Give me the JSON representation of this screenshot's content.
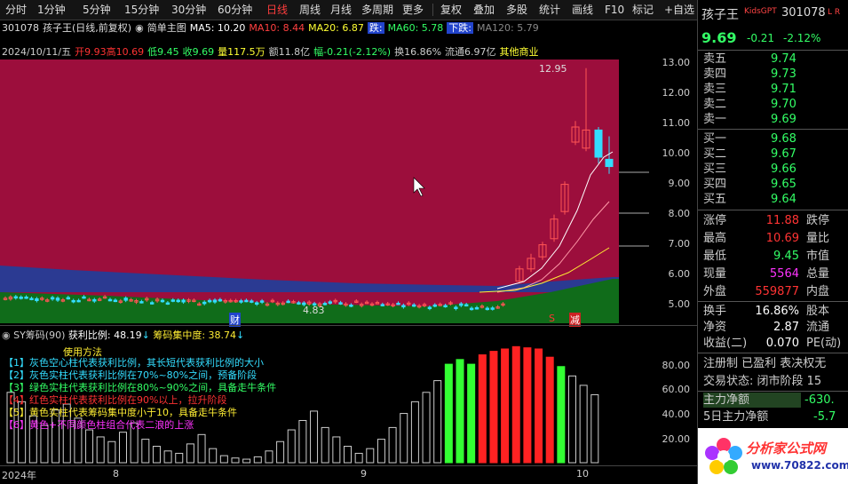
{
  "toolbar": {
    "items": [
      "分时",
      "1分钟",
      "5分钟",
      "15分钟",
      "30分钟",
      "60分钟",
      "日线",
      "周线",
      "月线",
      "多周期",
      "更多",
      "复权",
      "叠加",
      "多股",
      "统计",
      "画线",
      "F10",
      "标记",
      "+自选",
      "返回"
    ]
  },
  "info": {
    "code": "301078",
    "name_title": "孩子王(日线,前复权)",
    "indicator_name": "简单主图",
    "ma5": "MA5: 10.20",
    "ma10": "MA10: 8.44",
    "ma20": "MA20: 6.87",
    "badge_pct": "跌:",
    "ma60": "MA60: 5.78",
    "ma60_prefix": "下跌:",
    "ma120": "MA120: 5.79",
    "date": "2024/10/11/五",
    "open": "开9.93",
    "high": "高10.69",
    "low": "低9.45",
    "close": "收9.69",
    "vol": "量117.5万",
    "amount": "额11.8亿",
    "change": "幅-0.21(-2.12%)",
    "turnover": "换16.86%",
    "float": "流通6.97亿",
    "industry": "其他商业"
  },
  "main_chart": {
    "y_labels": [
      "13.00",
      "12.00",
      "11.00",
      "10.00",
      "9.00",
      "8.00",
      "7.00",
      "6.00",
      "5.00"
    ],
    "peak_label": "12.95",
    "low_label": "4.83",
    "marker_cai": "财",
    "marker_s": "S",
    "marker_jian": "减"
  },
  "sub_chart": {
    "title": "SY筹码(90)",
    "profit_label": "获利比例: 48.19",
    "concentration_label": "筹码集中度: 38.74",
    "guide_title": "使用方法",
    "legend": [
      "【1】灰色空心柱代表获利比例，其长短代表获利比例的大小",
      "【2】灰色实柱代表获利比例在70%~80%之间，预备阶段",
      "【3】绿色实柱代表获利比例在80%~90%之间，具备走牛条件",
      "【4】红色实柱代表获利比例在90%以上，拉升阶段",
      "【5】黄色实柱代表筹码集中度小于10，具备走牛条件",
      "【6】黄色+不同颜色柱组合代表二浪的上涨",
      "【7】"
    ],
    "y_labels": [
      "80.00",
      "60.00",
      "40.00",
      "20.00"
    ],
    "bars": [
      {
        "v": 60,
        "t": "h"
      },
      {
        "v": 52,
        "t": "h"
      },
      {
        "v": 40,
        "t": "h"
      },
      {
        "v": 32,
        "t": "h"
      },
      {
        "v": 45,
        "t": "h"
      },
      {
        "v": 50,
        "t": "h"
      },
      {
        "v": 38,
        "t": "h"
      },
      {
        "v": 28,
        "t": "h"
      },
      {
        "v": 22,
        "t": "h"
      },
      {
        "v": 18,
        "t": "h"
      },
      {
        "v": 26,
        "t": "h"
      },
      {
        "v": 34,
        "t": "h"
      },
      {
        "v": 20,
        "t": "h"
      },
      {
        "v": 14,
        "t": "h"
      },
      {
        "v": 10,
        "t": "h"
      },
      {
        "v": 8,
        "t": "h"
      },
      {
        "v": 16,
        "t": "h"
      },
      {
        "v": 24,
        "t": "h"
      },
      {
        "v": 12,
        "t": "h"
      },
      {
        "v": 6,
        "t": "h"
      },
      {
        "v": 4,
        "t": "h"
      },
      {
        "v": 3,
        "t": "h"
      },
      {
        "v": 5,
        "t": "h"
      },
      {
        "v": 10,
        "t": "h"
      },
      {
        "v": 18,
        "t": "h"
      },
      {
        "v": 28,
        "t": "h"
      },
      {
        "v": 36,
        "t": "h"
      },
      {
        "v": 44,
        "t": "h"
      },
      {
        "v": 30,
        "t": "h"
      },
      {
        "v": 22,
        "t": "h"
      },
      {
        "v": 14,
        "t": "h"
      },
      {
        "v": 8,
        "t": "h"
      },
      {
        "v": 12,
        "t": "h"
      },
      {
        "v": 20,
        "t": "h"
      },
      {
        "v": 30,
        "t": "h"
      },
      {
        "v": 42,
        "t": "h"
      },
      {
        "v": 52,
        "t": "h"
      },
      {
        "v": 60,
        "t": "h"
      },
      {
        "v": 70,
        "t": "h"
      },
      {
        "v": 84,
        "t": "g"
      },
      {
        "v": 88,
        "t": "g"
      },
      {
        "v": 84,
        "t": "g"
      },
      {
        "v": 92,
        "t": "r"
      },
      {
        "v": 95,
        "t": "r"
      },
      {
        "v": 97,
        "t": "r"
      },
      {
        "v": 99,
        "t": "r"
      },
      {
        "v": 98,
        "t": "r"
      },
      {
        "v": 97,
        "t": "r"
      },
      {
        "v": 90,
        "t": "r"
      },
      {
        "v": 82,
        "t": "g"
      },
      {
        "v": 74,
        "t": "h"
      },
      {
        "v": 66,
        "t": "h"
      },
      {
        "v": 58,
        "t": "h"
      }
    ]
  },
  "x_labels": [
    "2024年",
    "8",
    "9",
    "10"
  ],
  "quote": {
    "name": "孩子王",
    "badge": "KidsGPT",
    "code": "301078",
    "lr": "L R",
    "price": "9.69",
    "change": "-0.21",
    "pct": "-2.12%",
    "sells": [
      {
        "label": "卖五",
        "price": "9.74"
      },
      {
        "label": "卖四",
        "price": "9.73"
      },
      {
        "label": "卖三",
        "price": "9.71"
      },
      {
        "label": "卖二",
        "price": "9.70"
      },
      {
        "label": "卖一",
        "price": "9.69"
      }
    ],
    "buys": [
      {
        "label": "买一",
        "price": "9.68"
      },
      {
        "label": "买二",
        "price": "9.67"
      },
      {
        "label": "买三",
        "price": "9.66"
      },
      {
        "label": "买四",
        "price": "9.65"
      },
      {
        "label": "买五",
        "price": "9.64"
      }
    ],
    "stats": [
      {
        "label": "涨停",
        "value": "11.88",
        "label2": "跌停"
      },
      {
        "label": "最高",
        "value": "10.69",
        "label2": "量比"
      },
      {
        "label": "最低",
        "value": "9.45",
        "label2": "市值"
      },
      {
        "label": "现量",
        "value": "5564",
        "label2": "总量"
      },
      {
        "label": "外盘",
        "value": "559877",
        "label2": "内盘"
      }
    ],
    "stats2": [
      {
        "label": "换手",
        "value": "16.86%",
        "label2": "股本"
      },
      {
        "label": "净资",
        "value": "2.87",
        "label2": "流通"
      },
      {
        "label": "收益(二)",
        "value": "0.070",
        "label2": "PE(动)"
      }
    ],
    "reg_line": "注册制 已盈利 表决权无",
    "trade_status": "交易状态: 闭市阶段 15",
    "main_net_label": "主力净额",
    "main_net_value": "-630.",
    "main5_label": "5日主力净额",
    "main5_value": "-5.7",
    "watermark": "分析家公式网",
    "watermark_url": "www.70822.com"
  },
  "colors": {
    "accent_red": "#ff3333",
    "green": "#33ff66",
    "yellow": "#ffff33",
    "magenta": "#ff33ff",
    "cyan": "#33ddff",
    "bg_main": "#9c0e3c",
    "bg_green": "#106c1a",
    "bg_blue": "#2b3a92"
  }
}
